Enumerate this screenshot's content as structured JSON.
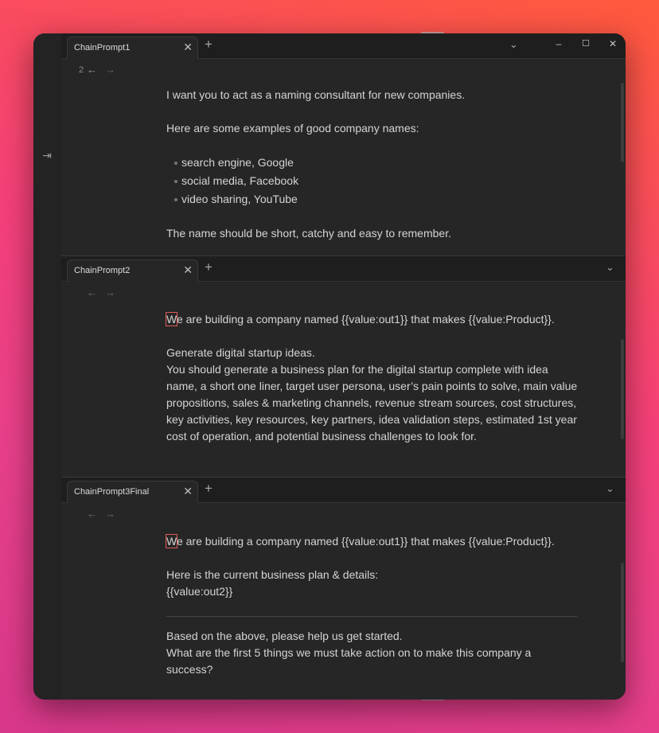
{
  "window": {
    "controls": {
      "minimize": "–",
      "maximize": "☐",
      "close": "✕"
    }
  },
  "panes": [
    {
      "tab_title": "ChainPrompt1",
      "nav_count": "2",
      "content": {
        "line1": "I want you to act as a naming consultant for new companies.",
        "line2": "Here are some examples of good company names:",
        "bullets": [
          "search engine, Google",
          "social media, Facebook",
          "video sharing, YouTube"
        ],
        "line3": "The name should be short, catchy and easy to remember."
      }
    },
    {
      "tab_title": "ChainPrompt2",
      "content": {
        "first_char": "W",
        "line1_rest": "e are building a company named {{value:out1}} that makes {{value:Product}}.",
        "line2": "Generate digital startup ideas.",
        "line3": "You should generate a business plan for the digital startup complete with idea name, a short one liner, target user persona, user’s pain points to solve, main value propositions, sales & marketing channels, revenue stream sources, cost structures, key activities, key resources, key partners, idea validation steps, estimated 1st year cost of operation, and potential business challenges to look for."
      }
    },
    {
      "tab_title": "ChainPrompt3Final",
      "content": {
        "first_char": "W",
        "line1_rest": "e are building a company named {{value:out1}} that makes {{value:Product}}.",
        "line2": "Here is the current business plan & details:",
        "line3": "{{value:out2}}",
        "line4": "Based on the above, please help us get started.",
        "line5": "What are the first 5 things we must take action on to make this company a success?"
      }
    }
  ],
  "icons": {
    "close": "✕",
    "plus": "+",
    "chevron_down": "⌄",
    "arrow_left": "←",
    "arrow_right": "→",
    "sidebar_expand": "⇥"
  }
}
